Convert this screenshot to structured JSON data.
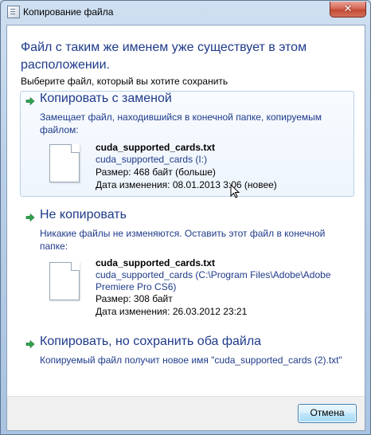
{
  "window": {
    "title": "Копирование файла",
    "close_label": "✕"
  },
  "dialog": {
    "heading": "Файл с таким же именем уже существует в этом расположении.",
    "subheading": "Выберите файл, который вы хотите сохранить"
  },
  "options": [
    {
      "title": "Копировать с заменой",
      "description": "Замещает файл, находившийся в конечной папке, копируемым файлом:",
      "file": {
        "name": "cuda_supported_cards.txt",
        "location": "cuda_supported_cards (I:)",
        "size": "Размер: 468 байт (больше)",
        "modified": "Дата изменения: 08.01.2013 3:06 (новее)"
      }
    },
    {
      "title": "Не копировать",
      "description": "Никакие файлы не изменяются. Оставить этот файл в конечной папке:",
      "file": {
        "name": "cuda_supported_cards.txt",
        "location": "cuda_supported_cards (C:\\Program Files\\Adobe\\Adobe Premiere Pro CS6)",
        "size": "Размер: 308 байт",
        "modified": "Дата изменения: 26.03.2012 23:21"
      }
    },
    {
      "title": "Копировать, но сохранить оба файла",
      "description": "Копируемый файл получит новое имя \"cuda_supported_cards (2).txt\""
    }
  ],
  "footer": {
    "cancel_label": "Отмена"
  },
  "colors": {
    "link": "#1e3a8a",
    "arrow": "#2ea44f",
    "close": "#c94f3a"
  },
  "icons": {
    "option_arrow": "green-right-arrow-icon",
    "file": "text-file-icon",
    "cursor": "mouse-pointer-icon"
  }
}
